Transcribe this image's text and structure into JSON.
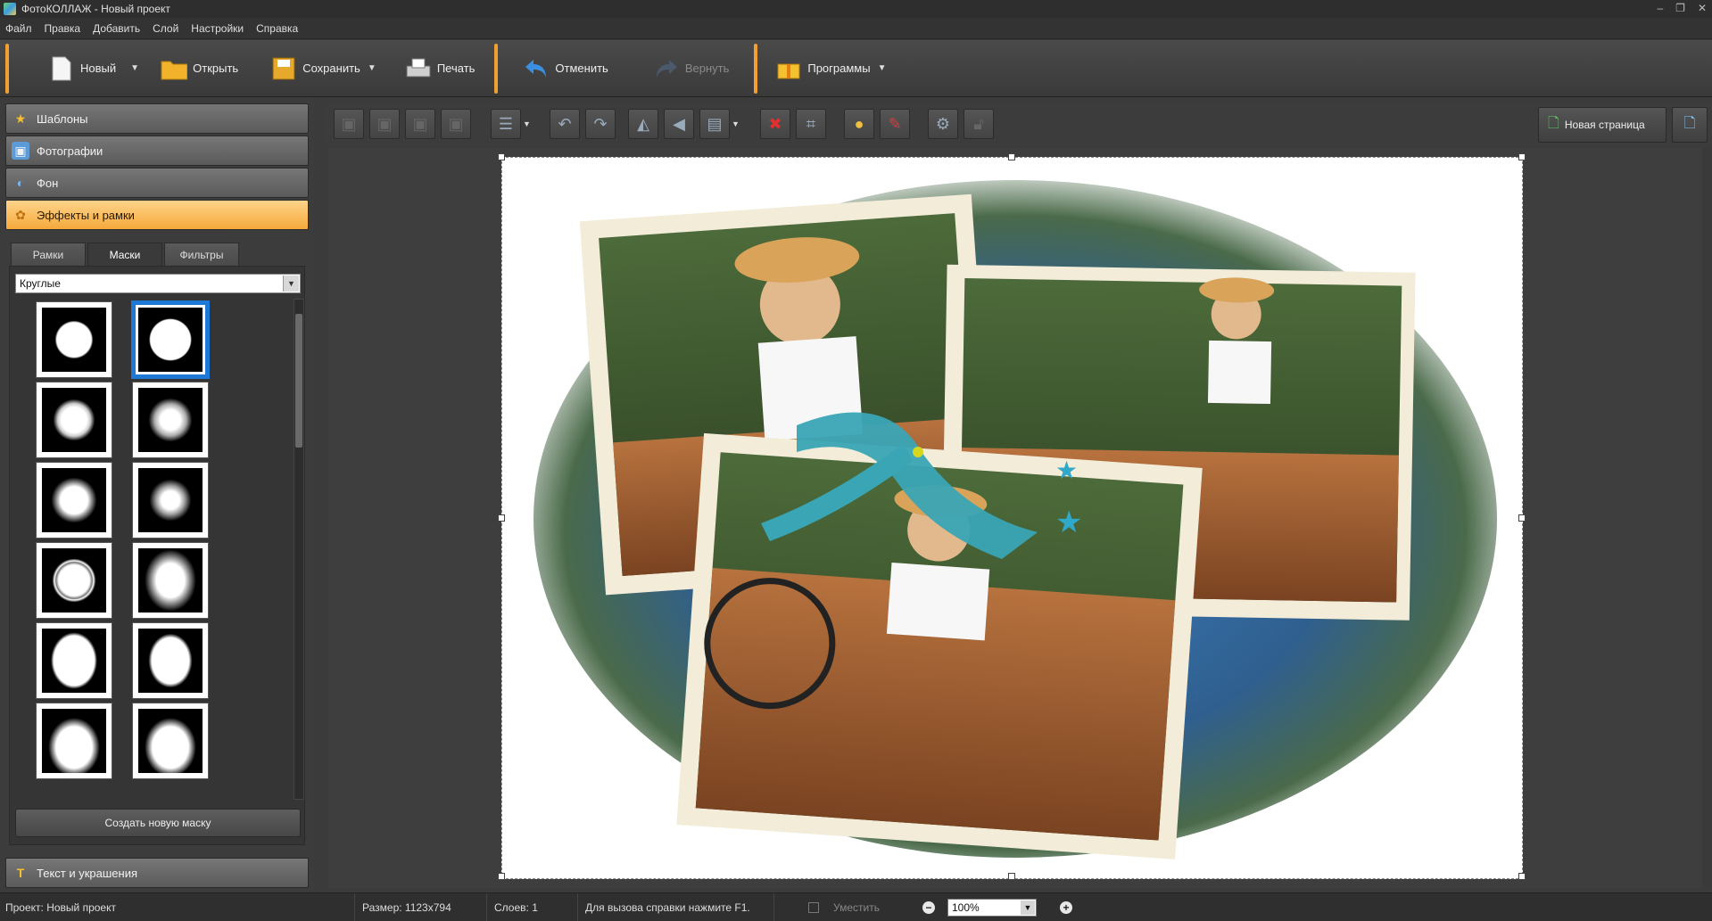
{
  "window": {
    "title": "ФотоКОЛЛАЖ - Новый проект"
  },
  "menu": [
    "Файл",
    "Правка",
    "Добавить",
    "Слой",
    "Настройки",
    "Справка"
  ],
  "toolbar": {
    "new_label": "Новый",
    "open_label": "Открыть",
    "save_label": "Сохранить",
    "print_label": "Печать",
    "undo_label": "Отменить",
    "redo_label": "Вернуть",
    "programs_label": "Программы"
  },
  "sidebar": {
    "sections": [
      "Шаблоны",
      "Фотографии",
      "Фон",
      "Эффекты и рамки"
    ],
    "bottom_section": "Текст и украшения",
    "tabs": [
      "Рамки",
      "Маски",
      "Фильтры"
    ],
    "active_tab": "Маски",
    "category": "Круглые",
    "create_mask_label": "Создать новую маску",
    "masks": [
      "mask-round-1",
      "mask-round-2",
      "mask-burst",
      "mask-swirl",
      "mask-soft-round",
      "mask-spiky",
      "mask-ring",
      "mask-soft-oval",
      "mask-oval",
      "mask-oval-rough"
    ],
    "selected_mask": "mask-round-2"
  },
  "editbar": {
    "new_page_label": "Новая страница"
  },
  "status": {
    "project": "Проект:  Новый проект",
    "size": "Размер:  1123x794",
    "layers": "Слоев:  1",
    "help": "Для вызова справки нажмите F1.",
    "fit_label": "Уместить",
    "zoom": "100%"
  },
  "colors": {
    "accent": "#f5a93a",
    "selection": "#1e78d6"
  }
}
